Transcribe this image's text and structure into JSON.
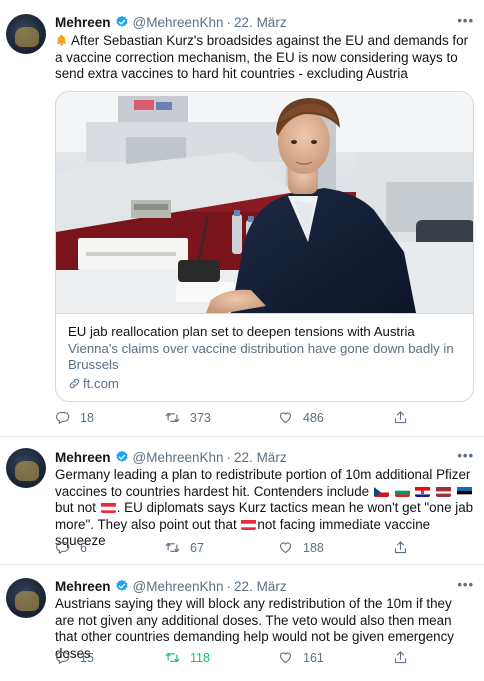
{
  "tweets": [
    {
      "name": "Mehreen",
      "handle": "@MehreenKhn",
      "separator": "·",
      "date": "22. März",
      "text": "After Sebastian Kurz's broadsides against the EU and demands for a vaccine correction mechanism, the EU is now considering ways to send extra vaccines to hard hit countries - excluding Austria",
      "card": {
        "title": "EU jab reallocation plan set to deepen tensions with Austria",
        "description": "Vienna's claims over vaccine distribution have gone down badly in Brussels",
        "domain": "ft.com"
      },
      "replies": "18",
      "retweets": "373",
      "likes": "486"
    },
    {
      "name": "Mehreen",
      "handle": "@MehreenKhn",
      "separator": "·",
      "date": "22. März",
      "text_a": "Germany leading a plan to redistribute portion of 10m additional Pfizer vaccines to countries hardest hit. Contenders include",
      "text_b": "but",
      "text_c": "not",
      "text_d": ". EU diplomats says Kurz tactics mean he won't get \"one jab more\". They also point out that",
      "text_e": "not facing immediate vaccine squeeze",
      "replies": "6",
      "retweets": "67",
      "likes": "188"
    },
    {
      "name": "Mehreen",
      "handle": "@MehreenKhn",
      "separator": "·",
      "date": "22. März",
      "text": "Austrians saying they will block any redistribution of the 10m if they are not given any additional doses. The veto would also then mean that other countries demanding help would not be given emergency doses",
      "replies": "15",
      "retweets": "118",
      "likes": "161"
    }
  ],
  "colors": {
    "accent": "#1da1f2",
    "retweeted": "#17bf63",
    "muted": "#5b7083"
  },
  "more_label": "•••",
  "emoji": {
    "bell": "bell-icon"
  }
}
